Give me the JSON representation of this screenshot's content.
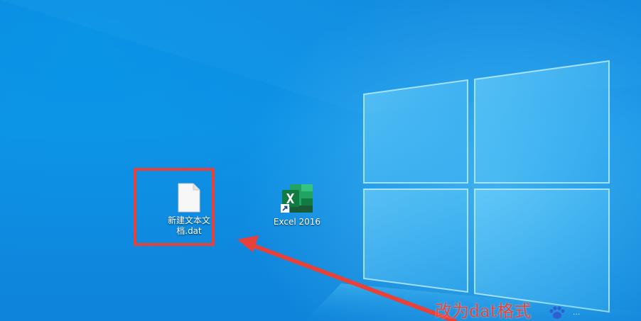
{
  "desktop": {
    "icons": [
      {
        "label_line1": "新建文本文",
        "label_line2": "档.dat",
        "icon": "text-file-icon"
      },
      {
        "label": "Excel 2016",
        "icon": "excel-icon",
        "shortcut_overlay": "shortcut-arrow-icon"
      }
    ]
  },
  "annotation": {
    "caption": "改为dat格式",
    "highlight_color": "#e8413a"
  },
  "watermark": {
    "logo": "paw-icon",
    "text": "..."
  },
  "colors": {
    "wallpaper": "#0f8fe4",
    "accent": "#e8413a",
    "excel_green": "#1d6f42"
  }
}
